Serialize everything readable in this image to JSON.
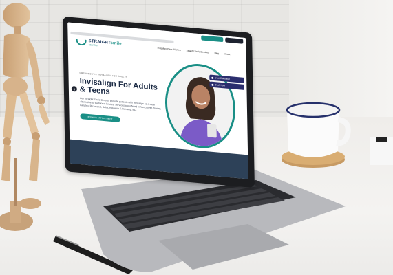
{
  "scene": {
    "description_tags": [
      "laptop",
      "desk",
      "coffee-mug",
      "wooden-mannequin",
      "pen",
      "brick-wall"
    ]
  },
  "website": {
    "topbar": {
      "primary_label": "",
      "secondary_label": ""
    },
    "logo": {
      "name_part1": "STRAIGHT",
      "name_part2": "smile",
      "subtitle": "CENTRES"
    },
    "nav": {
      "items": [
        "Invisalign Clear Aligners",
        "Straight Smile Services",
        "Blog",
        "About"
      ]
    },
    "hero": {
      "eyebrow": "ORTHODONTIC INVISALIGN FOR ADULTS",
      "headline": "Invisalign For Adults & Teens",
      "body": "Our Straight Smile Centres provide patients with Invisalign as a clear alternative to traditional braces. Services are offered in Vancouver, Surrey, Langley, Richmond, Delta, Kelowna & Burnaby, BC.",
      "cta_label": "BOOK AN APPOINTMENT"
    },
    "quick_buttons": {
      "cost_calculator": "Cost Calculator",
      "book_now": "Book Now"
    },
    "side_icon_label": "S"
  },
  "colors": {
    "teal": "#1a8f86",
    "navy": "#1b2a44",
    "purple_button": "#2b2e6e",
    "mug_rim": "#25306b"
  }
}
